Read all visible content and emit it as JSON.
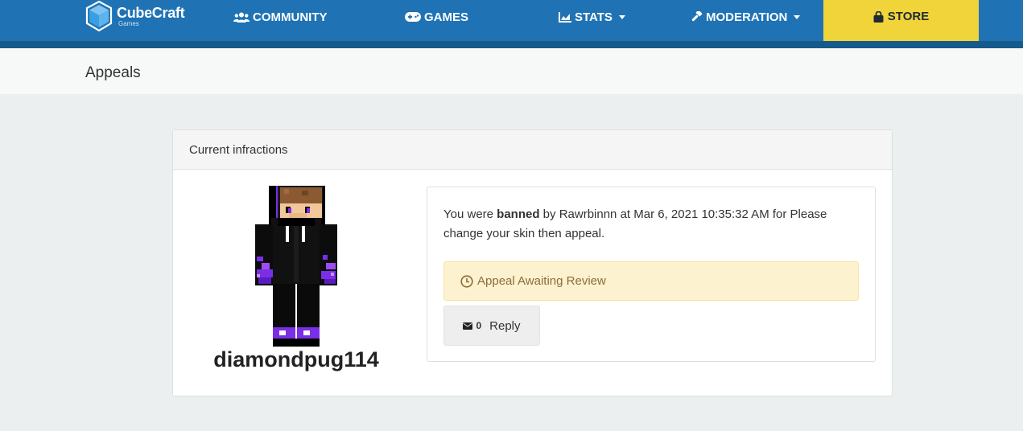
{
  "navbar": {
    "brand_name": "CubeCraft",
    "brand_sub": "Games",
    "items": [
      {
        "label": "COMMUNITY",
        "icon": "users-icon"
      },
      {
        "label": "GAMES",
        "icon": "gamepad-icon"
      },
      {
        "label": "STATS",
        "icon": "chart-icon",
        "dropdown": true
      },
      {
        "label": "MODERATION",
        "icon": "gavel-icon",
        "dropdown": true
      }
    ],
    "store_label": "STORE",
    "colors": {
      "bar": "#1f73b5",
      "strip": "#165a8c",
      "store": "#f1d43a"
    }
  },
  "page": {
    "title": "Appeals"
  },
  "panel": {
    "heading": "Current infractions",
    "player": {
      "name": "diamondpug114"
    },
    "infraction": {
      "prefix": "You were ",
      "action": "banned",
      "suffix": " by Rawrbinnn at Mar 6, 2021 10:35:32 AM for Please change your skin then appeal.",
      "status": "Appeal Awaiting Review",
      "reply_count": "0",
      "reply_label": "Reply"
    }
  }
}
